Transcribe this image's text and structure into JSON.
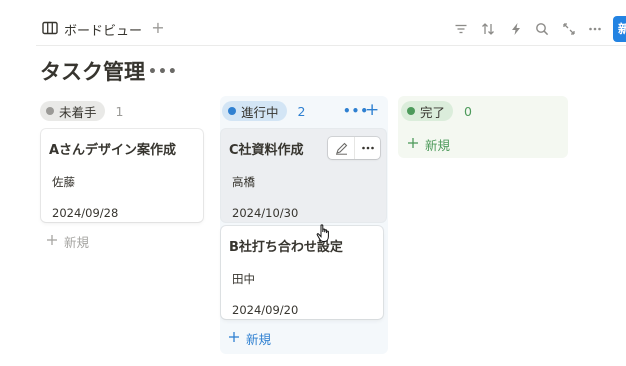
{
  "toolbar": {
    "view_label": "ボードビュー",
    "add_view": "+",
    "new_label": "新規",
    "icons": [
      "filter-icon",
      "sort-icon",
      "automation-icon",
      "search-icon",
      "expand-icon",
      "more-icon"
    ]
  },
  "page": {
    "title": "タスク管理",
    "more": "•••"
  },
  "columns": [
    {
      "status": "未着手",
      "count": "1",
      "dot_color": "#9b9a97",
      "pill_bg": "#e9e9e7",
      "cards": [
        {
          "title": "Aさんデザイン案作成",
          "assignee": "佐藤",
          "date": "2024/09/28"
        }
      ],
      "new_label": "新規"
    },
    {
      "status": "進行中",
      "count": "2",
      "dot_color": "#2f80d1",
      "pill_bg": "#d3e5f5",
      "more": "•••",
      "add": "+",
      "cards": [
        {
          "title": "C社資料作成",
          "assignee": "高橋",
          "date": "2024/10/30"
        },
        {
          "title": "B社打ち合わせ設定",
          "assignee": "田中",
          "date": "2024/09/20"
        }
      ],
      "new_label": "新規"
    },
    {
      "status": "完了",
      "count": "0",
      "dot_color": "#4d9a5b",
      "pill_bg": "#dbeddb",
      "cards": [],
      "new_label": "新規"
    }
  ],
  "colors": {
    "accent": "#2383e2",
    "in_progress_bg": "#f4f8fb",
    "done_bg": "#f4f8f1"
  }
}
